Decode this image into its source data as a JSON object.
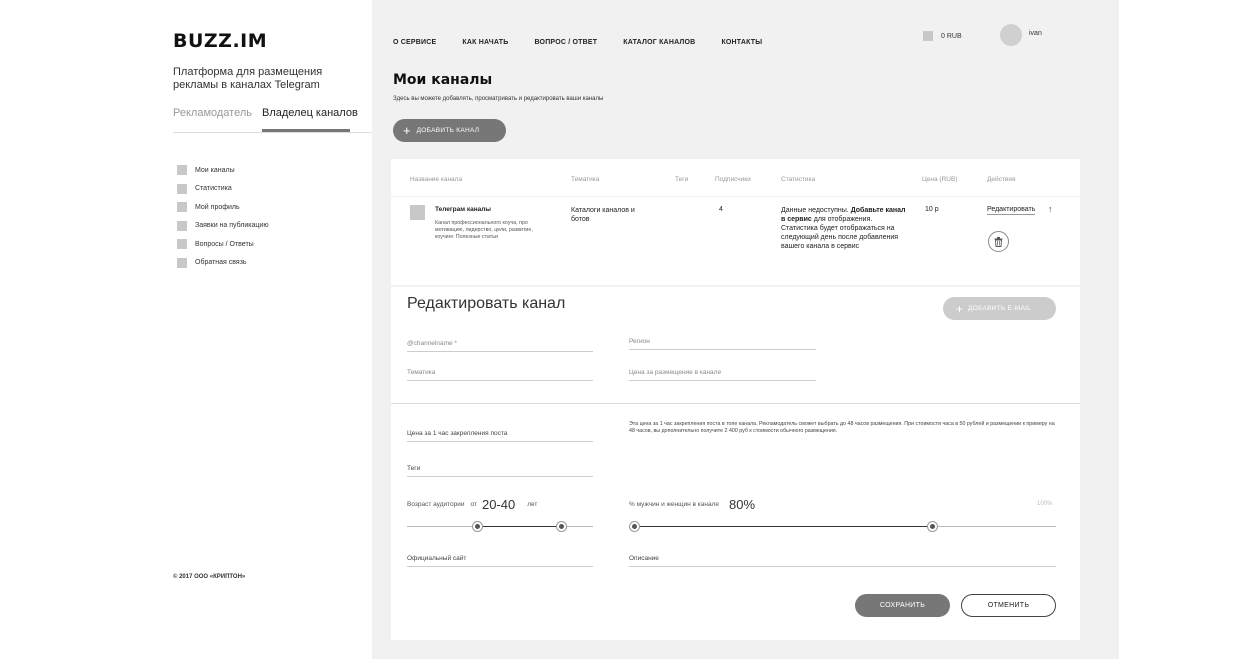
{
  "brand": {
    "logo": "BUZZ.IM",
    "tagline": "Платформа для размещения рекламы в каналах Telegram",
    "copyright": "© 2017 ООО «КРИПТОН»"
  },
  "role_tabs": [
    "Рекламодатель",
    "Владелец каналов"
  ],
  "sidebar": {
    "items": [
      {
        "label": "Мои каналы"
      },
      {
        "label": "Статистика"
      },
      {
        "label": "Мой профиль"
      },
      {
        "label": "Заявки на публикацию"
      },
      {
        "label": "Вопросы / Ответы"
      },
      {
        "label": "Обратная связь"
      }
    ]
  },
  "topnav": [
    "О СЕРВИСЕ",
    "КАК НАЧАТЬ",
    "ВОПРОС / ОТВЕТ",
    "КАТАЛОГ КАНАЛОВ",
    "КОНТАКТЫ"
  ],
  "balance": "0 RUB",
  "user": {
    "name": "ivan"
  },
  "page": {
    "title": "Мои каналы",
    "subtitle": "Здесь вы можете добавлять, просматривать и редактировать ваши каналы",
    "add_channel": "ДОБАВИТЬ КАНАЛ"
  },
  "table": {
    "headers": [
      "Название канала",
      "Тематика",
      "Теги",
      "Подписчики",
      "Статистика",
      "Цена (RUB)",
      "Действия"
    ],
    "row": {
      "name": "Телеграм каналы",
      "description": "Канал профессионального коуча, про мотивацию, лидерство, цели, развитие, коучинг. Полезные статьи",
      "topic": "Каталоги каналов и ботов",
      "subscribers": "4",
      "stats_plain1": "Данные недоступны. ",
      "stats_bold": "Добавьте канал в сервис",
      "stats_plain2": " для отображения. Статистика будет отображаться на следующий день после добавления вашего канала в сервис",
      "price": "10 р",
      "edit": "Редактировать",
      "arrow": "↑"
    }
  },
  "edit_form": {
    "title": "Редактировать канал",
    "add_email": "ДОБАВИТЬ E-MAIL",
    "channelname": "@channelname *",
    "region": "Регион",
    "topic": "Тематика",
    "price_channel": "Цена за размещение в канале",
    "price_pin": "Цена за 1 час закрепления поста",
    "hint": "Эта цена за 1 час закрепления поста в топе канала. Рекламодатель сможет выбрать до 48 часов размещения. При стоимости часа в 50 рублей и размещении к примеру на 48 часов, вы дополнительно получите 2 400 руб к стоимости обычного размещения.",
    "tags": "Теги",
    "age_label": "Возраст аудитории",
    "age_from": "от",
    "age_value": "20-40",
    "age_unit": "лет",
    "age_range": [
      0.38,
      0.83
    ],
    "gender_label": "% мужчин и женщин в канале",
    "gender_value": "80%",
    "gender_max": "100%",
    "gender_level": 0.71,
    "site": "Официальный сайт",
    "description": "Описание",
    "save": "СОХРАНИТЬ",
    "cancel": "ОТМЕНИТЬ"
  }
}
